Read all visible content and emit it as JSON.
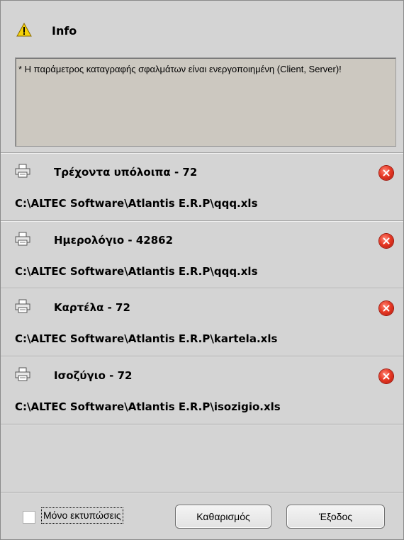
{
  "info": {
    "title": "Info",
    "message": "* Η παράμετρος καταγραφής σφαλμάτων είναι ενεργοποιημένη (Client, Server)!"
  },
  "reports": [
    {
      "title": "Τρέχοντα υπόλοιπα - 72",
      "path": "C:\\ALTEC Software\\Atlantis E.R.P\\qqq.xls"
    },
    {
      "title": "Ημερολόγιο - 42862",
      "path": "C:\\ALTEC Software\\Atlantis E.R.P\\qqq.xls"
    },
    {
      "title": "Καρτέλα - 72",
      "path": "C:\\ALTEC Software\\Atlantis E.R.P\\kartela.xls"
    },
    {
      "title": "Ισοζύγιο - 72",
      "path": "C:\\ALTEC Software\\Atlantis E.R.P\\isozigio.xls"
    }
  ],
  "footer": {
    "only_prints_label": "Μόνο εκτυπώσεις",
    "only_prints_checked": false,
    "clear_label": "Καθαρισμός",
    "exit_label": "Έξοδος"
  },
  "icons": {
    "info": "warning-icon",
    "report": "printer-icon",
    "remove": "remove-icon"
  },
  "colors": {
    "panel": "#d4d4d4",
    "info_box": "#ccc8c0",
    "remove": "#e83a26"
  }
}
